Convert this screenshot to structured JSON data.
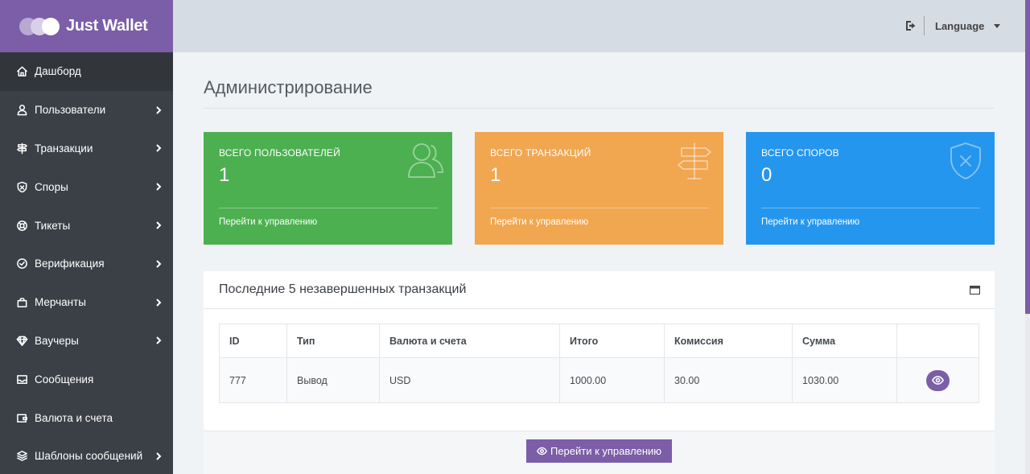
{
  "brand": {
    "name": "Just Wallet",
    "color": "#7b5ea7"
  },
  "sidebar": {
    "items": [
      {
        "label": "Дашборд",
        "icon": "home-icon",
        "active": true,
        "has_children": false
      },
      {
        "label": "Пользователи",
        "icon": "users-icon",
        "has_children": true
      },
      {
        "label": "Транзакции",
        "icon": "signpost-icon",
        "has_children": true
      },
      {
        "label": "Споры",
        "icon": "shield-icon",
        "has_children": true
      },
      {
        "label": "Тикеты",
        "icon": "lifebuoy-icon",
        "has_children": true
      },
      {
        "label": "Верификация",
        "icon": "check-circle-icon",
        "has_children": true
      },
      {
        "label": "Мерчанты",
        "icon": "shopping-bag-icon",
        "has_children": true
      },
      {
        "label": "Ваучеры",
        "icon": "diamond-icon",
        "has_children": true
      },
      {
        "label": "Сообщения",
        "icon": "inbox-icon",
        "has_children": false
      },
      {
        "label": "Валюта и счета",
        "icon": "wallet-icon",
        "has_children": false
      },
      {
        "label": "Шаблоны сообщений",
        "icon": "layers-icon",
        "has_children": true
      }
    ]
  },
  "header": {
    "language_label": "Language"
  },
  "main": {
    "title": "Администрирование",
    "cards": [
      {
        "title": "Всего пользователей",
        "value": "1",
        "link": "Перейти к управлению",
        "color": "#4cb050",
        "icon": "users-icon"
      },
      {
        "title": "Всего транзакций",
        "value": "1",
        "link": "Перейти к управлению",
        "color": "#f1a650",
        "icon": "signpost-icon"
      },
      {
        "title": "Всего споров",
        "value": "0",
        "link": "Перейти к управлению",
        "color": "#2596ee",
        "icon": "shield-x-icon"
      }
    ],
    "panel": {
      "title": "Последние 5 незавершенных транзакций",
      "columns": [
        "ID",
        "Тип",
        "Валюта и счета",
        "Итого",
        "Комиссия",
        "Сумма",
        ""
      ],
      "rows": [
        {
          "id": "777",
          "type": "Вывод",
          "currency": "USD",
          "total": "1000.00",
          "fee": "30.00",
          "amount": "1030.00"
        }
      ],
      "footer_button": "Перейти к управлению"
    }
  }
}
